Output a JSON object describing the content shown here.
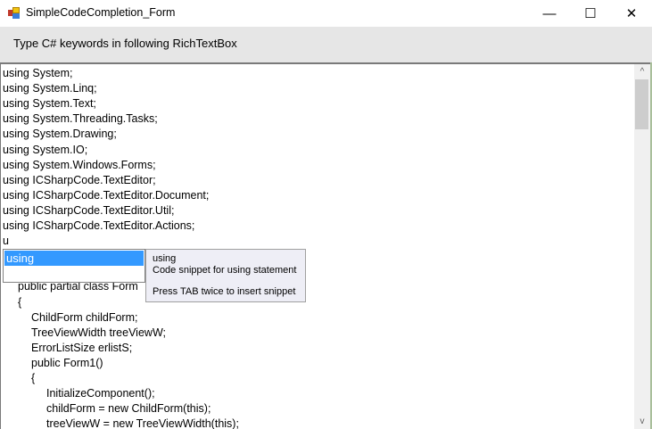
{
  "window": {
    "title": "SimpleCodeCompletion_Form",
    "minimize": "—",
    "maximize": "☐",
    "close": "✕"
  },
  "panel": {
    "label": "Type C# keywords in following RichTextBox"
  },
  "editor": {
    "lines": [
      {
        "text": "using System;",
        "indent": 0,
        "row": 0
      },
      {
        "text": "using System.Linq;",
        "indent": 0,
        "row": 1
      },
      {
        "text": "using System.Text;",
        "indent": 0,
        "row": 2
      },
      {
        "text": "using System.Threading.Tasks;",
        "indent": 0,
        "row": 3
      },
      {
        "text": "using System.Drawing;",
        "indent": 0,
        "row": 4
      },
      {
        "text": "using System.IO;",
        "indent": 0,
        "row": 5
      },
      {
        "text": "using System.Windows.Forms;",
        "indent": 0,
        "row": 6
      },
      {
        "text": "using ICSharpCode.TextEditor;",
        "indent": 0,
        "row": 7
      },
      {
        "text": "using ICSharpCode.TextEditor.Document;",
        "indent": 0,
        "row": 8
      },
      {
        "text": "using ICSharpCode.TextEditor.Util;",
        "indent": 0,
        "row": 9
      },
      {
        "text": "using ICSharpCode.TextEditor.Actions;",
        "indent": 0,
        "row": 10
      },
      {
        "text": "u",
        "indent": 0,
        "row": 11
      },
      {
        "text": "public partial class Form",
        "indent": 1,
        "row": 14
      },
      {
        "text": "{",
        "indent": 1,
        "row": 15
      },
      {
        "text": "ChildForm childForm;",
        "indent": 2,
        "row": 16
      },
      {
        "text": "TreeViewWidth treeViewW;",
        "indent": 2,
        "row": 17
      },
      {
        "text": "ErrorListSize erlistS;",
        "indent": 2,
        "row": 18
      },
      {
        "text": "public Form1()",
        "indent": 2,
        "row": 19
      },
      {
        "text": "{",
        "indent": 2,
        "row": 20
      },
      {
        "text": "InitializeComponent();",
        "indent": 3,
        "row": 21
      },
      {
        "text": "childForm = new ChildForm(this);",
        "indent": 3,
        "row": 22
      },
      {
        "text": "treeViewW = new TreeViewWidth(this);",
        "indent": 3,
        "row": 23
      }
    ]
  },
  "completion": {
    "selected": "using",
    "tooltip": {
      "title": "using",
      "description": "Code snippet for using statement",
      "hint": "Press TAB twice to insert snippet"
    }
  },
  "scrollbar": {
    "up": "^",
    "down": "v"
  }
}
